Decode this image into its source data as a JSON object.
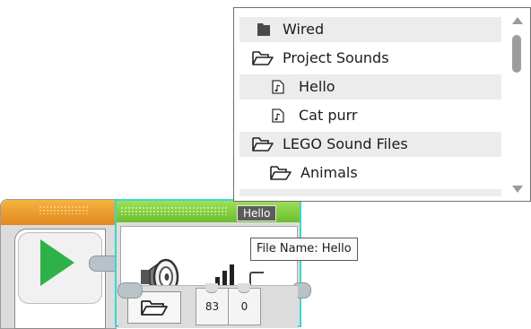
{
  "sound_block": {
    "name_tag": "Hello",
    "volume": "83",
    "play_type": "0"
  },
  "tooltip": {
    "text": "File Name: Hello"
  },
  "file_browser": {
    "items": [
      {
        "label": "Wired",
        "icon": "solid-folder-icon"
      },
      {
        "label": "Project Sounds",
        "icon": "folder-outline-icon"
      },
      {
        "label": "Hello",
        "icon": "sound-file-icon"
      },
      {
        "label": "Cat purr",
        "icon": "sound-file-icon"
      },
      {
        "label": "LEGO Sound Files",
        "icon": "folder-outline-icon"
      },
      {
        "label": "Animals",
        "icon": "folder-outline-icon"
      }
    ]
  },
  "colors": {
    "start_header": "#e8952a",
    "sound_header": "#7fcb3a",
    "selection_outline": "#3ad6d2",
    "play_green": "#2fb14a",
    "name_tag_bg": "#5c5c5c"
  }
}
